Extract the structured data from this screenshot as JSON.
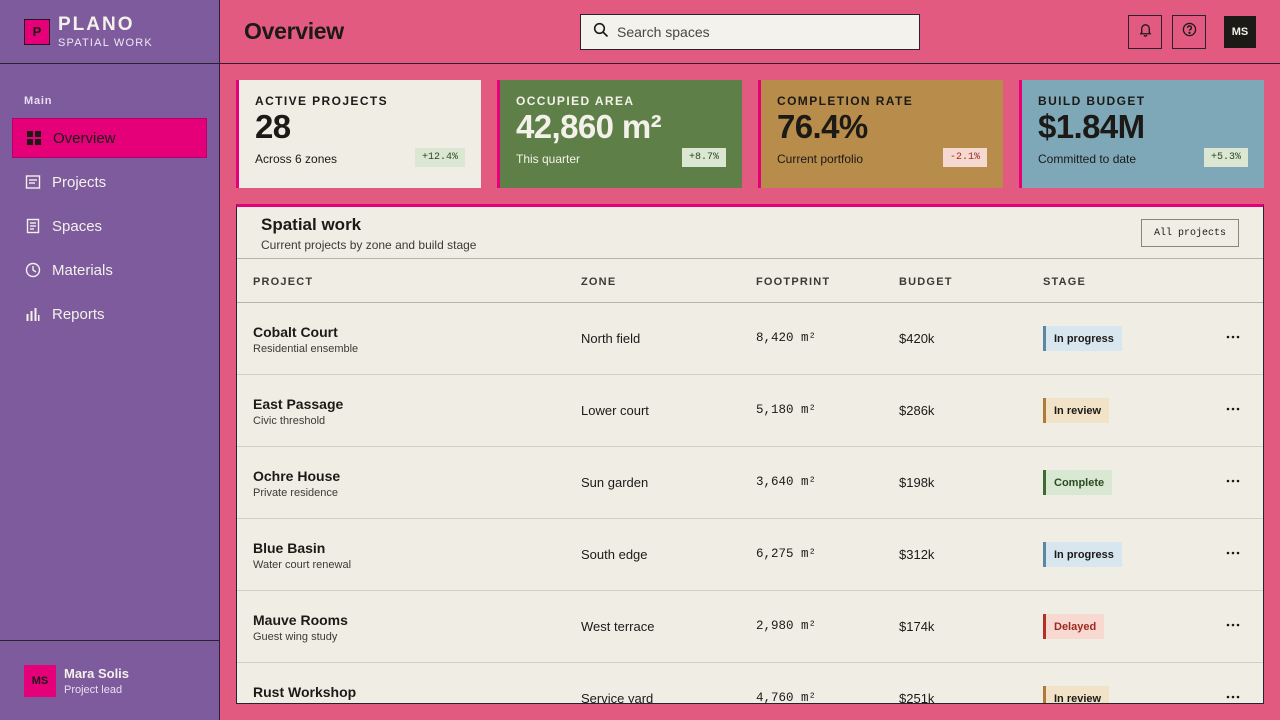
{
  "brand": {
    "logo_letter": "P",
    "name": "PLANO",
    "subtitle": "SPATIAL WORK"
  },
  "sidebar": {
    "section_label": "Main",
    "items": [
      {
        "label": "Overview",
        "icon": "grid-icon",
        "active": true
      },
      {
        "label": "Projects",
        "icon": "projects-icon",
        "active": false
      },
      {
        "label": "Spaces",
        "icon": "spaces-icon",
        "active": false
      },
      {
        "label": "Materials",
        "icon": "clock-icon",
        "active": false
      },
      {
        "label": "Reports",
        "icon": "bar-chart-icon",
        "active": false
      }
    ],
    "user": {
      "initials": "MS",
      "name": "Mara Solis",
      "role": "Project lead"
    }
  },
  "header": {
    "title": "Overview",
    "search_placeholder": "Search spaces",
    "avatar_initials": "MS",
    "icons": [
      "bell-icon",
      "help-icon"
    ]
  },
  "stats": [
    {
      "label": "ACTIVE PROJECTS",
      "value": "28",
      "sub": "Across 6 zones",
      "badge": "+12.4%",
      "bg": "#f0ede5",
      "text": "#1c1a17",
      "badge_bg": "#dbe7d3",
      "badge_color": "#2d4a22"
    },
    {
      "label": "OCCUPIED AREA",
      "value": "42,860 m²",
      "sub": "This quarter",
      "badge": "+8.7%",
      "bg": "#5e8048",
      "text": "#f4f1ea",
      "badge_bg": "#dbe7d3",
      "badge_color": "#2d4a22"
    },
    {
      "label": "COMPLETION RATE",
      "value": "76.4%",
      "sub": "Current portfolio",
      "badge": "-2.1%",
      "bg": "#b88c4a",
      "text": "#1c1a17",
      "badge_bg": "#f5d9d0",
      "badge_color": "#9c2a1e"
    },
    {
      "label": "BUILD BUDGET",
      "value": "$1.84M",
      "sub": "Committed to date",
      "badge": "+5.3%",
      "bg": "#7ea8b8",
      "text": "#1c1a17",
      "badge_bg": "#dbe7d3",
      "badge_color": "#2d4a22"
    }
  ],
  "table": {
    "title": "Spatial work",
    "subtitle": "Current projects by zone and build stage",
    "filter_label": "All projects",
    "columns": [
      "PROJECT",
      "ZONE",
      "FOOTPRINT",
      "BUDGET",
      "STAGE"
    ],
    "rows": [
      {
        "name": "Cobalt Court",
        "desc": "Residential ensemble",
        "zone": "North field",
        "footprint": "8,420 m²",
        "budget": "$420k",
        "stage": "In progress"
      },
      {
        "name": "East Passage",
        "desc": "Civic threshold",
        "zone": "Lower court",
        "footprint": "5,180 m²",
        "budget": "$286k",
        "stage": "In review"
      },
      {
        "name": "Ochre House",
        "desc": "Private residence",
        "zone": "Sun garden",
        "footprint": "3,640 m²",
        "budget": "$198k",
        "stage": "Complete"
      },
      {
        "name": "Blue Basin",
        "desc": "Water court renewal",
        "zone": "South edge",
        "footprint": "6,275 m²",
        "budget": "$312k",
        "stage": "In progress"
      },
      {
        "name": "Mauve Rooms",
        "desc": "Guest wing study",
        "zone": "West terrace",
        "footprint": "2,980 m²",
        "budget": "$174k",
        "stage": "Delayed"
      },
      {
        "name": "Rust Workshop",
        "desc": "",
        "zone": "Service yard",
        "footprint": "4,760 m²",
        "budget": "$251k",
        "stage": "In review"
      }
    ]
  },
  "stage_colors": {
    "In progress": {
      "bg": "#d8e6ef",
      "border": "#5b87a0",
      "text": "#1c1a17"
    },
    "In review": {
      "bg": "#f1e2c8",
      "border": "#b07a35",
      "text": "#1c1a17"
    },
    "Complete": {
      "bg": "#d8e8d2",
      "border": "#3f6a33",
      "text": "#2d4a22"
    },
    "Delayed": {
      "bg": "#f7d9d2",
      "border": "#b03226",
      "text": "#9c2a1e"
    }
  }
}
